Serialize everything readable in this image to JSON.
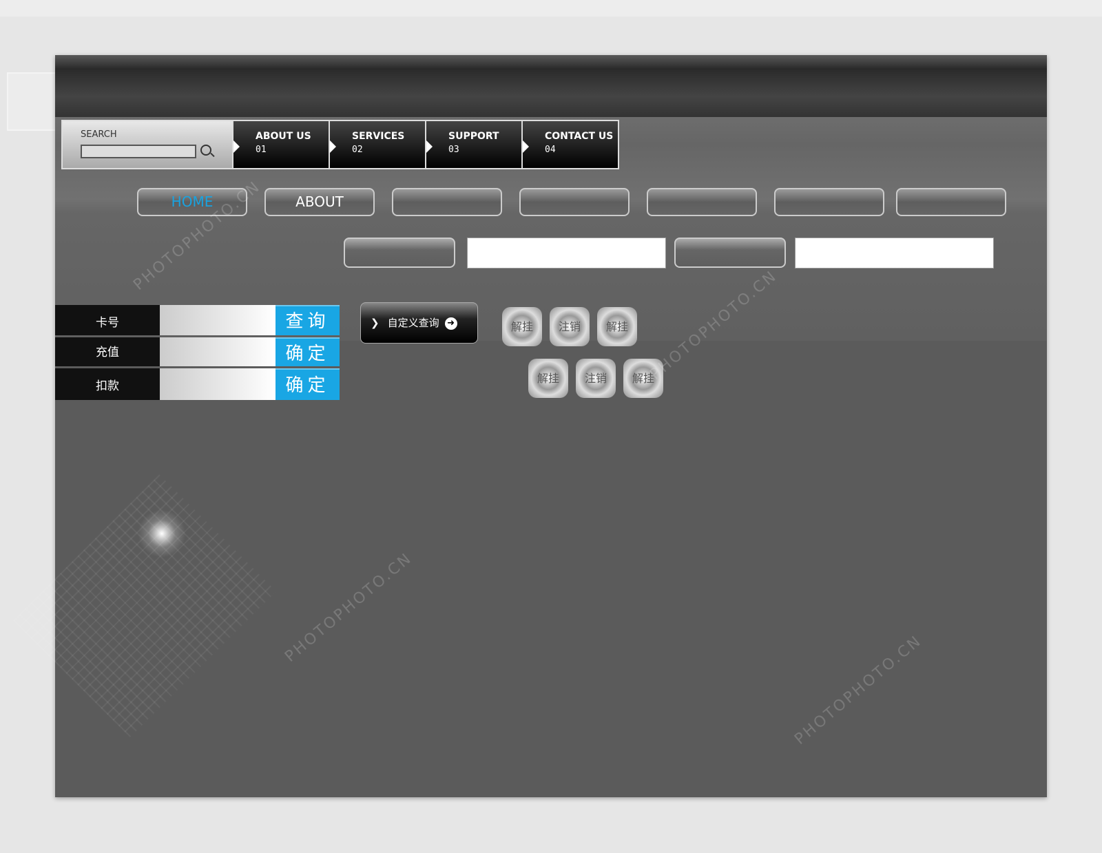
{
  "nav": {
    "search_label": "SEARCH",
    "items": [
      {
        "label": "ABOUT US",
        "num": "01"
      },
      {
        "label": "SERVICES",
        "num": "02"
      },
      {
        "label": "SUPPORT",
        "num": "03"
      },
      {
        "label": "CONTACT US",
        "num": "04"
      }
    ]
  },
  "pills": [
    "HOME",
    "ABOUT",
    "",
    "",
    "",
    "",
    ""
  ],
  "form": [
    {
      "label": "卡号",
      "button": "查询"
    },
    {
      "label": "充值",
      "button": "确定"
    },
    {
      "label": "扣款",
      "button": "确定"
    }
  ],
  "custom_query": "自定义查询",
  "metal_buttons_row1": [
    "解挂",
    "注销",
    "解挂"
  ],
  "metal_buttons_row2": [
    "解挂",
    "注销",
    "解挂"
  ],
  "watermark": "PHOTOPHOTO.CN",
  "colors": {
    "accent": "#19a6e4",
    "background": "#5b5b5b"
  }
}
